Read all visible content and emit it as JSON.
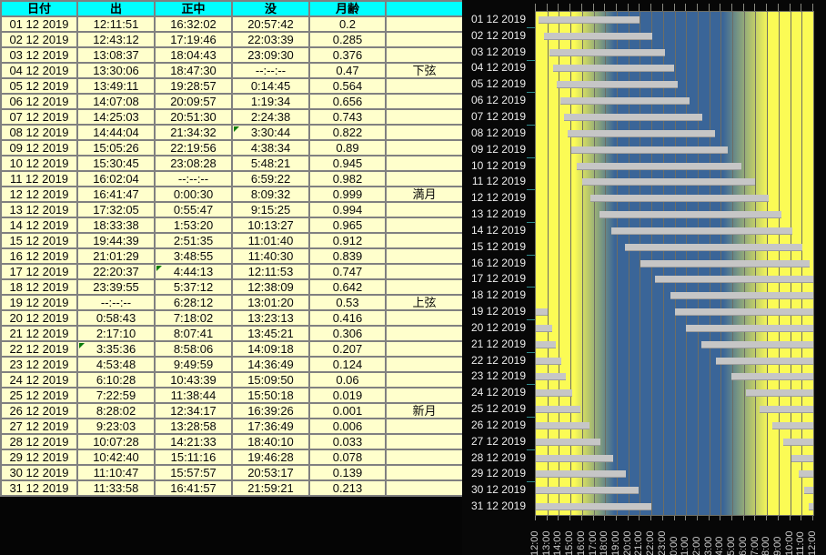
{
  "table": {
    "headers": [
      "日付",
      "出",
      "正中",
      "没",
      "月齢",
      ""
    ],
    "column_keys": [
      "date",
      "rise",
      "transit",
      "set",
      "age",
      "phase"
    ],
    "rows": [
      {
        "date": "01 12 2019",
        "rise": "12:11:51",
        "transit": "16:32:02",
        "set": "20:57:42",
        "age": "0.2",
        "phase": ""
      },
      {
        "date": "02 12 2019",
        "rise": "12:43:12",
        "transit": "17:19:46",
        "set": "22:03:39",
        "age": "0.285",
        "phase": ""
      },
      {
        "date": "03 12 2019",
        "rise": "13:08:37",
        "transit": "18:04:43",
        "set": "23:09:30",
        "age": "0.376",
        "phase": ""
      },
      {
        "date": "04 12 2019",
        "rise": "13:30:06",
        "transit": "18:47:30",
        "set": "--:--:--",
        "age": "0.47",
        "phase": "下弦"
      },
      {
        "date": "05 12 2019",
        "rise": "13:49:11",
        "transit": "19:28:57",
        "set": "0:14:45",
        "age": "0.564",
        "phase": ""
      },
      {
        "date": "06 12 2019",
        "rise": "14:07:08",
        "transit": "20:09:57",
        "set": "1:19:34",
        "age": "0.656",
        "phase": ""
      },
      {
        "date": "07 12 2019",
        "rise": "14:25:03",
        "transit": "20:51:30",
        "set": "2:24:38",
        "age": "0.743",
        "phase": ""
      },
      {
        "date": "08 12 2019",
        "rise": "14:44:04",
        "transit": "21:34:32",
        "set": "3:30:44",
        "age": "0.822",
        "phase": ""
      },
      {
        "date": "09 12 2019",
        "rise": "15:05:26",
        "transit": "22:19:56",
        "set": "4:38:34",
        "age": "0.89",
        "phase": ""
      },
      {
        "date": "10 12 2019",
        "rise": "15:30:45",
        "transit": "23:08:28",
        "set": "5:48:21",
        "age": "0.945",
        "phase": ""
      },
      {
        "date": "11 12 2019",
        "rise": "16:02:04",
        "transit": "--:--:--",
        "set": "6:59:22",
        "age": "0.982",
        "phase": ""
      },
      {
        "date": "12 12 2019",
        "rise": "16:41:47",
        "transit": "0:00:30",
        "set": "8:09:32",
        "age": "0.999",
        "phase": "満月"
      },
      {
        "date": "13 12 2019",
        "rise": "17:32:05",
        "transit": "0:55:47",
        "set": "9:15:25",
        "age": "0.994",
        "phase": ""
      },
      {
        "date": "14 12 2019",
        "rise": "18:33:38",
        "transit": "1:53:20",
        "set": "10:13:27",
        "age": "0.965",
        "phase": ""
      },
      {
        "date": "15 12 2019",
        "rise": "19:44:39",
        "transit": "2:51:35",
        "set": "11:01:40",
        "age": "0.912",
        "phase": ""
      },
      {
        "date": "16 12 2019",
        "rise": "21:01:29",
        "transit": "3:48:55",
        "set": "11:40:30",
        "age": "0.839",
        "phase": ""
      },
      {
        "date": "17 12 2019",
        "rise": "22:20:37",
        "transit": "4:44:13",
        "set": "12:11:53",
        "age": "0.747",
        "phase": ""
      },
      {
        "date": "18 12 2019",
        "rise": "23:39:55",
        "transit": "5:37:12",
        "set": "12:38:09",
        "age": "0.642",
        "phase": ""
      },
      {
        "date": "19 12 2019",
        "rise": "--:--:--",
        "transit": "6:28:12",
        "set": "13:01:20",
        "age": "0.53",
        "phase": "上弦"
      },
      {
        "date": "20 12 2019",
        "rise": "0:58:43",
        "transit": "7:18:02",
        "set": "13:23:13",
        "age": "0.416",
        "phase": ""
      },
      {
        "date": "21 12 2019",
        "rise": "2:17:10",
        "transit": "8:07:41",
        "set": "13:45:21",
        "age": "0.306",
        "phase": ""
      },
      {
        "date": "22 12 2019",
        "rise": "3:35:36",
        "transit": "8:58:06",
        "set": "14:09:18",
        "age": "0.207",
        "phase": ""
      },
      {
        "date": "23 12 2019",
        "rise": "4:53:48",
        "transit": "9:49:59",
        "set": "14:36:49",
        "age": "0.124",
        "phase": ""
      },
      {
        "date": "24 12 2019",
        "rise": "6:10:28",
        "transit": "10:43:39",
        "set": "15:09:50",
        "age": "0.06",
        "phase": ""
      },
      {
        "date": "25 12 2019",
        "rise": "7:22:59",
        "transit": "11:38:44",
        "set": "15:50:18",
        "age": "0.019",
        "phase": ""
      },
      {
        "date": "26 12 2019",
        "rise": "8:28:02",
        "transit": "12:34:17",
        "set": "16:39:26",
        "age": "0.001",
        "phase": "新月"
      },
      {
        "date": "27 12 2019",
        "rise": "9:23:03",
        "transit": "13:28:58",
        "set": "17:36:49",
        "age": "0.006",
        "phase": ""
      },
      {
        "date": "28 12 2019",
        "rise": "10:07:28",
        "transit": "14:21:33",
        "set": "18:40:10",
        "age": "0.033",
        "phase": ""
      },
      {
        "date": "29 12 2019",
        "rise": "10:42:40",
        "transit": "15:11:16",
        "set": "19:46:28",
        "age": "0.078",
        "phase": ""
      },
      {
        "date": "30 12 2019",
        "rise": "11:10:47",
        "transit": "15:57:57",
        "set": "20:53:17",
        "age": "0.139",
        "phase": ""
      },
      {
        "date": "31 12 2019",
        "rise": "11:33:58",
        "transit": "16:41:57",
        "set": "21:59:21",
        "age": "0.213",
        "phase": ""
      }
    ],
    "corner_flags": [
      {
        "row": 8,
        "col": "set"
      },
      {
        "row": 17,
        "col": "transit"
      },
      {
        "row": 22,
        "col": "rise"
      }
    ]
  },
  "chart_data": {
    "type": "gantt",
    "description": "Moon above-horizon periods per date, noon-to-noon window over day/night background",
    "x_axis": {
      "start": "12:00",
      "span_hours": 24,
      "tick_labels": [
        "12:00",
        "13:00",
        "14:00",
        "15:00",
        "16:00",
        "17:00",
        "18:00",
        "19:00",
        "20:00",
        "21:00",
        "22:00",
        "23:00",
        "0:00",
        "1:00",
        "2:00",
        "3:00",
        "4:00",
        "5:00",
        "6:00",
        "7:00",
        "8:00",
        "9:00",
        "10:00",
        "11:00",
        "12:00"
      ]
    },
    "y_axis": {
      "dates": [
        "01 12 2019",
        "02 12 2019",
        "03 12 2019",
        "04 12 2019",
        "05 12 2019",
        "06 12 2019",
        "07 12 2019",
        "08 12 2019",
        "09 12 2019",
        "10 12 2019",
        "11 12 2019",
        "12 12 2019",
        "13 12 2019",
        "14 12 2019",
        "15 12 2019",
        "16 12 2019",
        "17 12 2019",
        "18 12 2019",
        "19 12 2019",
        "20 12 2019",
        "21 12 2019",
        "22 12 2019",
        "23 12 2019",
        "24 12 2019",
        "25 12 2019",
        "26 12 2019",
        "27 12 2019",
        "28 12 2019",
        "29 12 2019",
        "30 12 2019",
        "31 12 2019"
      ]
    },
    "bars_hours_from_noon": [
      [
        [
          0.2,
          8.96
        ]
      ],
      [
        [
          0.72,
          10.06
        ]
      ],
      [
        [
          1.14,
          11.16
        ]
      ],
      [
        [
          1.5,
          12.0
        ]
      ],
      [
        [
          1.82,
          12.25
        ]
      ],
      [
        [
          2.12,
          13.33
        ]
      ],
      [
        [
          2.42,
          14.41
        ]
      ],
      [
        [
          2.73,
          15.51
        ]
      ],
      [
        [
          3.09,
          16.64
        ]
      ],
      [
        [
          3.51,
          17.81
        ]
      ],
      [
        [
          4.03,
          18.99
        ]
      ],
      [
        [
          4.7,
          20.16
        ]
      ],
      [
        [
          5.53,
          21.26
        ]
      ],
      [
        [
          6.56,
          22.22
        ]
      ],
      [
        [
          7.74,
          23.03
        ]
      ],
      [
        [
          9.02,
          23.67
        ]
      ],
      [
        [
          10.34,
          24
        ]
      ],
      [
        [
          11.67,
          24
        ]
      ],
      [
        [
          0,
          1.02
        ],
        [
          12.0,
          24
        ]
      ],
      [
        [
          0,
          1.39
        ],
        [
          12.98,
          24
        ]
      ],
      [
        [
          0,
          1.76
        ],
        [
          14.29,
          24
        ]
      ],
      [
        [
          0,
          2.16
        ],
        [
          15.59,
          24
        ]
      ],
      [
        [
          0,
          2.61
        ],
        [
          16.9,
          24
        ]
      ],
      [
        [
          0,
          3.16
        ],
        [
          18.17,
          24
        ]
      ],
      [
        [
          0,
          3.84
        ],
        [
          19.38,
          24
        ]
      ],
      [
        [
          0,
          4.66
        ],
        [
          20.47,
          24
        ]
      ],
      [
        [
          0,
          5.61
        ],
        [
          21.38,
          24
        ]
      ],
      [
        [
          0,
          6.67
        ],
        [
          22.12,
          24
        ]
      ],
      [
        [
          0,
          7.77
        ],
        [
          22.71,
          24
        ]
      ],
      [
        [
          0,
          8.89
        ],
        [
          23.18,
          24
        ]
      ],
      [
        [
          0,
          9.99
        ],
        [
          23.57,
          24
        ]
      ]
    ],
    "day_night_gradient": {
      "day_color": "#fbfb55",
      "night_color": "#3a6598",
      "stops_pct": [
        14,
        28.5,
        67.5,
        84
      ]
    },
    "legend": "gray bar = moon above horizon; yellow = day; blue = night"
  },
  "colors": {
    "header_bg": "#00ffff",
    "cell_bg": "#ffffcc",
    "cell_border": "#808080",
    "flag_green": "#0b7d0b",
    "panel_bg": "#070707",
    "bar": "#c6c6c6",
    "grid": "#6e6e64",
    "date_label": "#ececec",
    "time_label": "#cfcfcf",
    "left_tick": "#2f8d8d"
  }
}
